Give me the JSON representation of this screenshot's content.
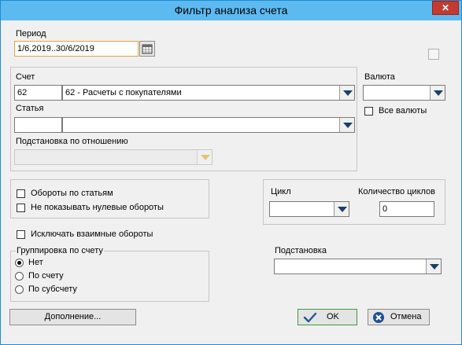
{
  "window": {
    "title": "Фильтр анализа счета",
    "close_glyph": "✕"
  },
  "period": {
    "label": "Период",
    "value": "1/6,2019..30/6/2019"
  },
  "account": {
    "label": "Счет",
    "code": "62",
    "name": "62 - Расчеты с покупателями"
  },
  "currency": {
    "label": "Валюта",
    "value": "",
    "all_currencies_label": "Все валюты"
  },
  "article": {
    "label": "Статья",
    "code": "",
    "name": ""
  },
  "relation_substitution": {
    "label": "Подстановка по отношению",
    "value": ""
  },
  "options": {
    "turnover_by_articles": "Обороты по статьям",
    "hide_zero_turnover": "Не показывать нулевые обороты",
    "exclude_mutual_turnover": "Исключать взаимные обороты"
  },
  "cycle": {
    "label": "Цикл",
    "value": "",
    "count_label": "Количество циклов",
    "count_value": "0"
  },
  "grouping": {
    "label": "Группировка по счету",
    "options": [
      "Нет",
      "По счету",
      "По субсчету"
    ],
    "selected_index": 0
  },
  "substitution": {
    "label": "Подстановка",
    "value": ""
  },
  "buttons": {
    "addition": "Дополнение...",
    "ok": "OK",
    "cancel": "Отмена"
  },
  "icons": {
    "calendar": "calendar-icon",
    "dropdown": "chevron-down-icon",
    "ok": "checkmark-icon",
    "cancel": "cancel-icon"
  },
  "colors": {
    "titlebar": "#5cbaf0",
    "close": "#c43a2f",
    "ok_border": "#3c9a3c",
    "accent_border": "#e8a33a"
  }
}
